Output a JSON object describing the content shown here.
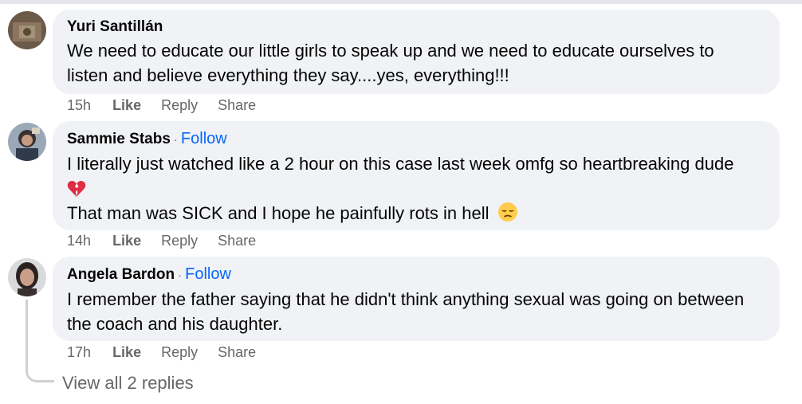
{
  "comments": [
    {
      "author": "Yuri Santillán",
      "follow_label": "",
      "lines": [
        "We need to educate our little girls to speak up and we need to educate ourselves to",
        "listen and believe everything they say....yes, everything!!!"
      ],
      "time": "15h",
      "like": "Like",
      "reply": "Reply",
      "share": "Share"
    },
    {
      "author": "Sammie Stabs",
      "follow_label": "Follow",
      "lines": [
        "I literally just watched like a 2 hour on this case last week omfg so heartbreaking dude",
        "That man was SICK and I hope he painfully rots in hell"
      ],
      "emojis": [
        "broken-heart-emoji",
        "disappointed-face-emoji"
      ],
      "time": "14h",
      "like": "Like",
      "reply": "Reply",
      "share": "Share"
    },
    {
      "author": "Angela Bardon",
      "follow_label": "Follow",
      "lines": [
        "I remember the father saying that he didn't think anything sexual was going on between",
        "the coach and his daughter."
      ],
      "time": "17h",
      "like": "Like",
      "reply": "Reply",
      "share": "Share"
    }
  ],
  "separator": "·",
  "view_replies": "View all 2 replies",
  "colors": {
    "bubble": "#f0f2f5",
    "link": "#0866ff",
    "meta": "#65676b"
  }
}
